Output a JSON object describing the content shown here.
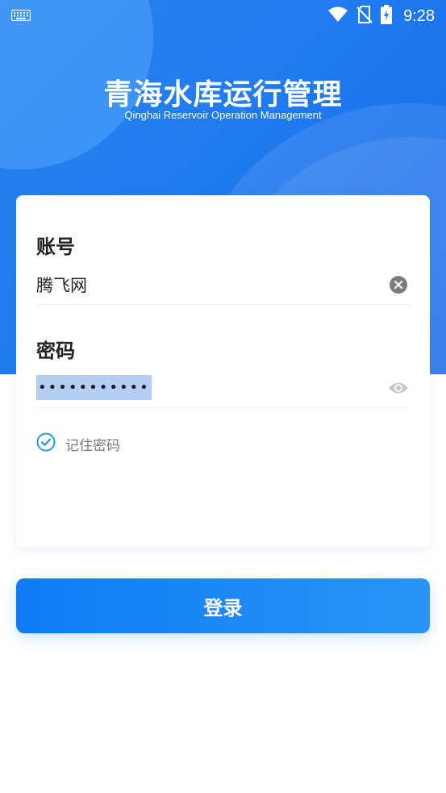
{
  "status_bar": {
    "time": "9:28",
    "icons": [
      "keyboard-icon",
      "wifi-icon",
      "no-sim-icon",
      "battery-charging-icon"
    ]
  },
  "header": {
    "title": "青海水库运行管理",
    "subtitle": "Qinghai Reservoir Operation Management"
  },
  "form": {
    "account": {
      "label": "账号",
      "value": "腾飞网",
      "clear_icon": "clear-icon"
    },
    "password": {
      "label": "密码",
      "masked_value": "•••••••••••",
      "visibility_icon": "eye-icon"
    },
    "remember": {
      "label": "记住密码",
      "checked": true
    }
  },
  "login_button": {
    "label": "登录"
  },
  "colors": {
    "primary": "#1f7bf0",
    "button_start": "#0f7cf6",
    "button_end": "#2a93f6",
    "checkbox": "#2596e6"
  }
}
